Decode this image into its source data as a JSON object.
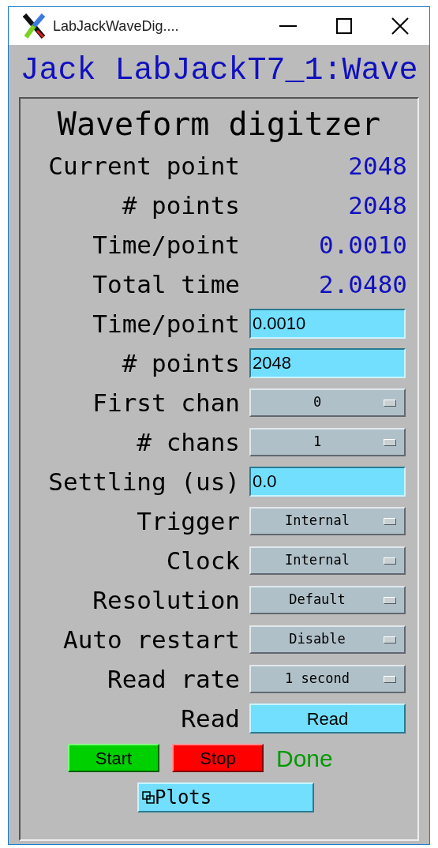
{
  "window": {
    "title": "LabJackWaveDig...."
  },
  "banner": "Jack LabJackT7_1:Wave",
  "panel": {
    "title": "Waveform digitzer",
    "rows": [
      {
        "kind": "readout",
        "label": "Current point",
        "value": "2048"
      },
      {
        "kind": "readout",
        "label": "# points",
        "value": "2048"
      },
      {
        "kind": "readout",
        "label": "Time/point",
        "value": "0.0010"
      },
      {
        "kind": "readout",
        "label": "Total time",
        "value": "2.0480"
      },
      {
        "kind": "input",
        "label": "Time/point",
        "value": "0.0010"
      },
      {
        "kind": "input",
        "label": "# points",
        "value": "2048"
      },
      {
        "kind": "menu",
        "label": "First chan",
        "value": "0"
      },
      {
        "kind": "menu",
        "label": "# chans",
        "value": "1"
      },
      {
        "kind": "input",
        "label": "Settling (us)",
        "value": "0.0"
      },
      {
        "kind": "menu",
        "label": "Trigger",
        "value": "Internal"
      },
      {
        "kind": "menu",
        "label": "Clock",
        "value": "Internal"
      },
      {
        "kind": "menu",
        "label": "Resolution",
        "value": "Default"
      },
      {
        "kind": "menu",
        "label": "Auto restart",
        "value": "Disable"
      },
      {
        "kind": "menu",
        "label": "Read rate",
        "value": "1 second"
      },
      {
        "kind": "button",
        "label": "Read",
        "value": "Read"
      }
    ],
    "start": "Start",
    "stop": "Stop",
    "status": "Done",
    "plots": "Plots"
  }
}
